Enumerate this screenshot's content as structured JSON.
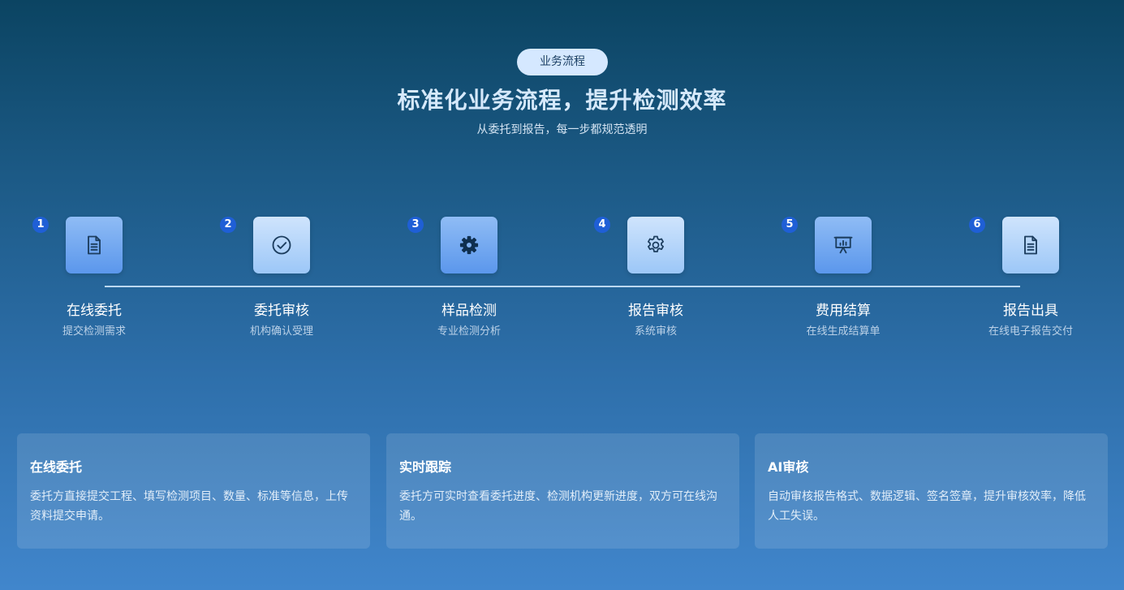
{
  "header": {
    "badge": "业务流程",
    "title": "标准化业务流程，提升检测效率",
    "subtitle": "从委托到报告，每一步都规范透明"
  },
  "steps": [
    {
      "num": "1",
      "title": "在线委托",
      "desc": "提交检测需求",
      "icon": "document-icon"
    },
    {
      "num": "2",
      "title": "委托审核",
      "desc": "机构确认受理",
      "icon": "check-circle-icon"
    },
    {
      "num": "3",
      "title": "样品检测",
      "desc": "专业检测分析",
      "icon": "gear-icon"
    },
    {
      "num": "4",
      "title": "报告审核",
      "desc": "系统审核",
      "icon": "settings-icon"
    },
    {
      "num": "5",
      "title": "费用结算",
      "desc": "在线生成结算单",
      "icon": "presentation-icon"
    },
    {
      "num": "6",
      "title": "报告出具",
      "desc": "在线电子报告交付",
      "icon": "document-icon"
    }
  ],
  "cards": [
    {
      "title": "在线委托",
      "text": "委托方直接提交工程、填写检测项目、数量、标准等信息，上传资料提交申请。"
    },
    {
      "title": "实时跟踪",
      "text": "委托方可实时查看委托进度、检测机构更新进度，双方可在线沟通。"
    },
    {
      "title": "AI审核",
      "text": "自动审核报告格式、数据逻辑、签名签章，提升审核效率，降低人工失误。"
    }
  ],
  "colors": {
    "accent": "#1f5fd6",
    "icon_stroke": "#1c3d5e",
    "badge_bg": "#d5e8ff"
  }
}
